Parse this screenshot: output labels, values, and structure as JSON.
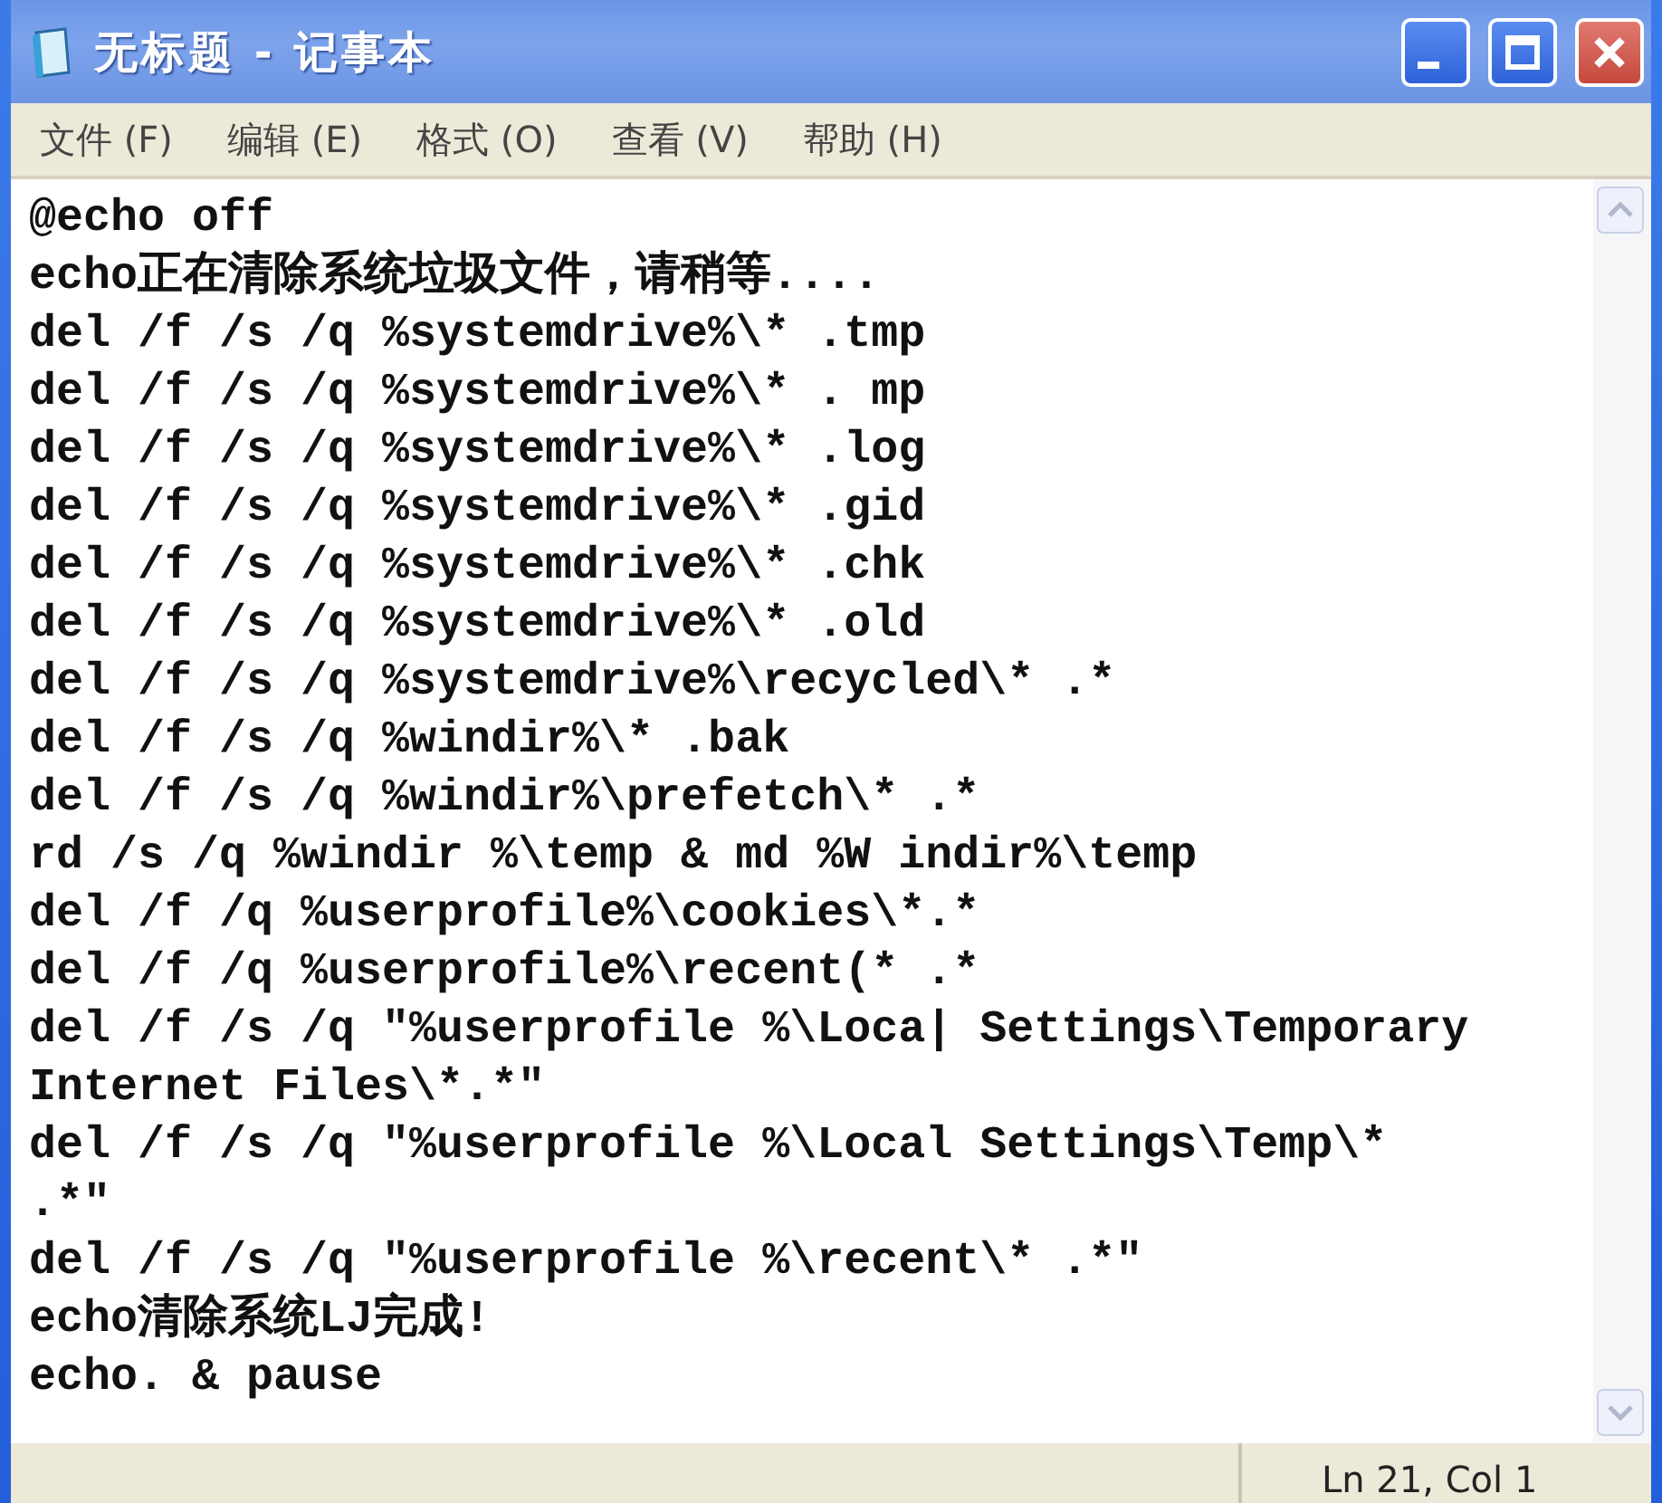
{
  "window": {
    "title": "无标题 - 记事本"
  },
  "menu": [
    "文件 (F)",
    "编辑 (E)",
    "格式 (O)",
    "查看 (V)",
    "帮助 (H)"
  ],
  "editor": {
    "lines": [
      "@echo off",
      "echo正在清除系统垃圾文件，请稍等....",
      "del /f /s /q %systemdrive%\\* .tmp",
      "del /f /s /q %systemdrive%\\* . mp",
      "del /f /s /q %systemdrive%\\* .log",
      "del /f /s /q %systemdrive%\\* .gid",
      "del /f /s /q %systemdrive%\\* .chk",
      "del /f /s /q %systemdrive%\\* .old",
      "del /f /s /q %systemdrive%\\recycled\\* .*",
      "del /f /s /q %windir%\\* .bak",
      "del /f /s /q %windir%\\prefetch\\* .*",
      "rd /s /q %windir %\\temp & md %W indir%\\temp",
      "del /f /q %userprofile%\\cookies\\*.*",
      "del /f /q %userprofile%\\recent(* .*",
      "del /f /s /q \"%userprofile %\\Loca| Settings\\Temporary",
      "Internet Files\\*.*\"",
      "del /f /s /q \"%userprofile %\\Local Settings\\Temp\\*",
      ".*\"",
      "del /f /s /q \"%userprofile %\\recent\\* .*\"",
      "echo清除系统LJ完成!",
      "echo. & pause"
    ]
  },
  "status_bar": {
    "position": "Ln 21, Col 1"
  }
}
